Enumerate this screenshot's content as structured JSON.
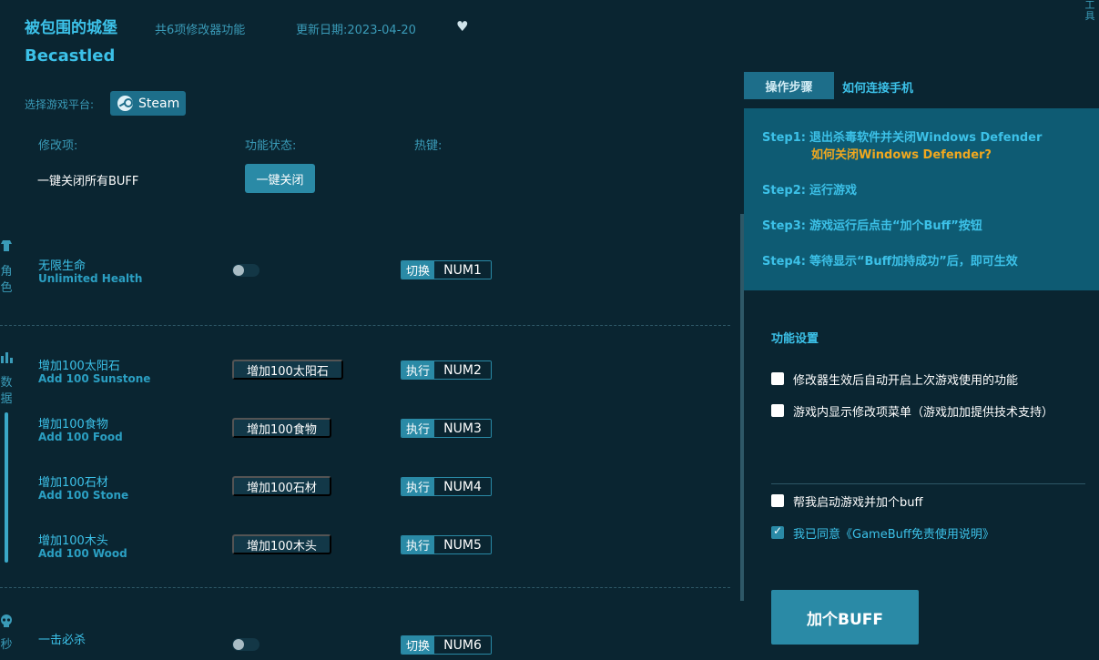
{
  "header": {
    "title_cn": "被包围的城堡",
    "feature_count": "共6项修改器功能",
    "update_date": "更新日期:2023-04-20",
    "title_en": "Becastled",
    "corner_tool": "工具"
  },
  "platform": {
    "label": "选择游戏平台:",
    "selected": "Steam"
  },
  "columns": {
    "item": "修改项:",
    "status": "功能状态:",
    "hotkey": "热键:"
  },
  "close_all": {
    "label": "一键关闭所有BUFF",
    "button": "一键关闭"
  },
  "categories": [
    {
      "name": "角色",
      "icon": "character-icon"
    },
    {
      "name": "数据",
      "icon": "data-icon"
    },
    {
      "name": "秒",
      "icon": "skull-icon"
    }
  ],
  "features": [
    {
      "name_cn": "无限生命",
      "name_en": "Unlimited Health",
      "type": "toggle",
      "action": "切换",
      "key": "NUM1"
    },
    {
      "name_cn": "增加100太阳石",
      "name_en": "Add 100 Sunstone",
      "type": "exec",
      "button": "增加100太阳石",
      "action": "执行",
      "key": "NUM2"
    },
    {
      "name_cn": "增加100食物",
      "name_en": "Add 100 Food",
      "type": "exec",
      "button": "增加100食物",
      "action": "执行",
      "key": "NUM3"
    },
    {
      "name_cn": "增加100石材",
      "name_en": "Add 100 Stone",
      "type": "exec",
      "button": "增加100石材",
      "action": "执行",
      "key": "NUM4"
    },
    {
      "name_cn": "增加100木头",
      "name_en": "Add 100 Wood",
      "type": "exec",
      "button": "增加100木头",
      "action": "执行",
      "key": "NUM5"
    },
    {
      "name_cn": "一击必杀",
      "name_en": "",
      "type": "toggle",
      "action": "切换",
      "key": "NUM6"
    }
  ],
  "right_panel": {
    "tab_active": "操作步骤",
    "tab_other": "如何连接手机",
    "steps": [
      {
        "label": "Step1:",
        "text": "退出杀毒软件并关闭Windows Defender"
      },
      {
        "label": "Step2:",
        "text": "运行游戏"
      },
      {
        "label": "Step3:",
        "text": "游戏运行后点击“加个Buff”按钮"
      },
      {
        "label": "Step4:",
        "text": "等待显示“Buff加持成功”后，即可生效"
      }
    ],
    "step1_link": "如何关闭Windows Defender?",
    "settings_title": "功能设置",
    "options": [
      {
        "label": "修改器生效后自动开启上次游戏使用的功能",
        "checked": false
      },
      {
        "label": "游戏内显示修改项菜单（游戏加加提供技术支持）",
        "checked": false
      },
      {
        "label": "帮我启动游戏并加个buff",
        "checked": false
      },
      {
        "label": "我已同意《GameBuff免责使用说明》",
        "checked": true
      }
    ],
    "buff_button": "加个BUFF"
  },
  "colors": {
    "background": "#0a2531",
    "accent": "#3cc1e8",
    "button": "#2a8aa6",
    "steps_panel": "#0e5b73",
    "link_orange": "#f0a81f"
  }
}
